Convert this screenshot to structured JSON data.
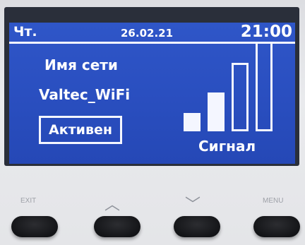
{
  "status_bar": {
    "day": "Чт.",
    "date": "26.02.21",
    "time": "21:00"
  },
  "network": {
    "label": "Имя сети",
    "name": "Valtec_WiFi",
    "status": "Активен"
  },
  "signal": {
    "label": "Сигнал",
    "bars_total": 4,
    "bars_filled": 2
  },
  "buttons": {
    "exit_label": "EXIT",
    "up_glyph": "︿",
    "down_glyph": "﹀",
    "menu_label": "MENU"
  },
  "colors": {
    "screen": "#2a4fc0",
    "text": "#ffffff",
    "keys": "#17181b"
  }
}
